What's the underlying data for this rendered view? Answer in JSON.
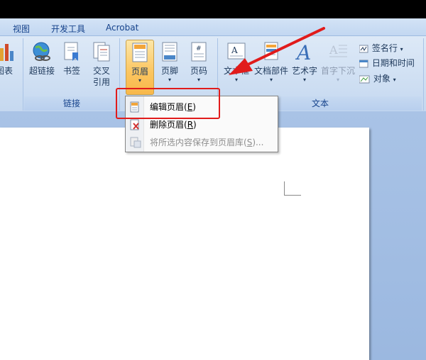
{
  "tabs": [
    {
      "label": "视图"
    },
    {
      "label": "开发工具"
    },
    {
      "label": "Acrobat"
    }
  ],
  "groups": {
    "links": {
      "label": "链接"
    },
    "text": {
      "label": "文本"
    }
  },
  "buttons": {
    "chart_partial": "图表",
    "hyperlink": "超链接",
    "bookmark": "书签",
    "cross_ref_line1": "交叉",
    "cross_ref_line2": "引用",
    "header": "页眉",
    "footer": "页脚",
    "page_number": "页码",
    "textbox": "文本框",
    "quick_parts": "文档部件",
    "wordart": "艺术字",
    "dropcap": "首字下沉",
    "signature_line": "签名行",
    "date_time": "日期和时间",
    "object": "对象"
  },
  "menu": {
    "items": [
      {
        "label": "编辑页眉(",
        "key": "E",
        "suffix": ")",
        "enabled": true
      },
      {
        "label": "删除页眉(",
        "key": "R",
        "suffix": ")",
        "enabled": true
      },
      {
        "label": "将所选内容保存到页眉库(",
        "key": "S",
        "suffix": ")...",
        "enabled": false
      }
    ]
  },
  "colors": {
    "annotation_red": "#e11b1b",
    "ribbon_bg": "#d0e0f3",
    "active_button": "#fbc55f"
  }
}
